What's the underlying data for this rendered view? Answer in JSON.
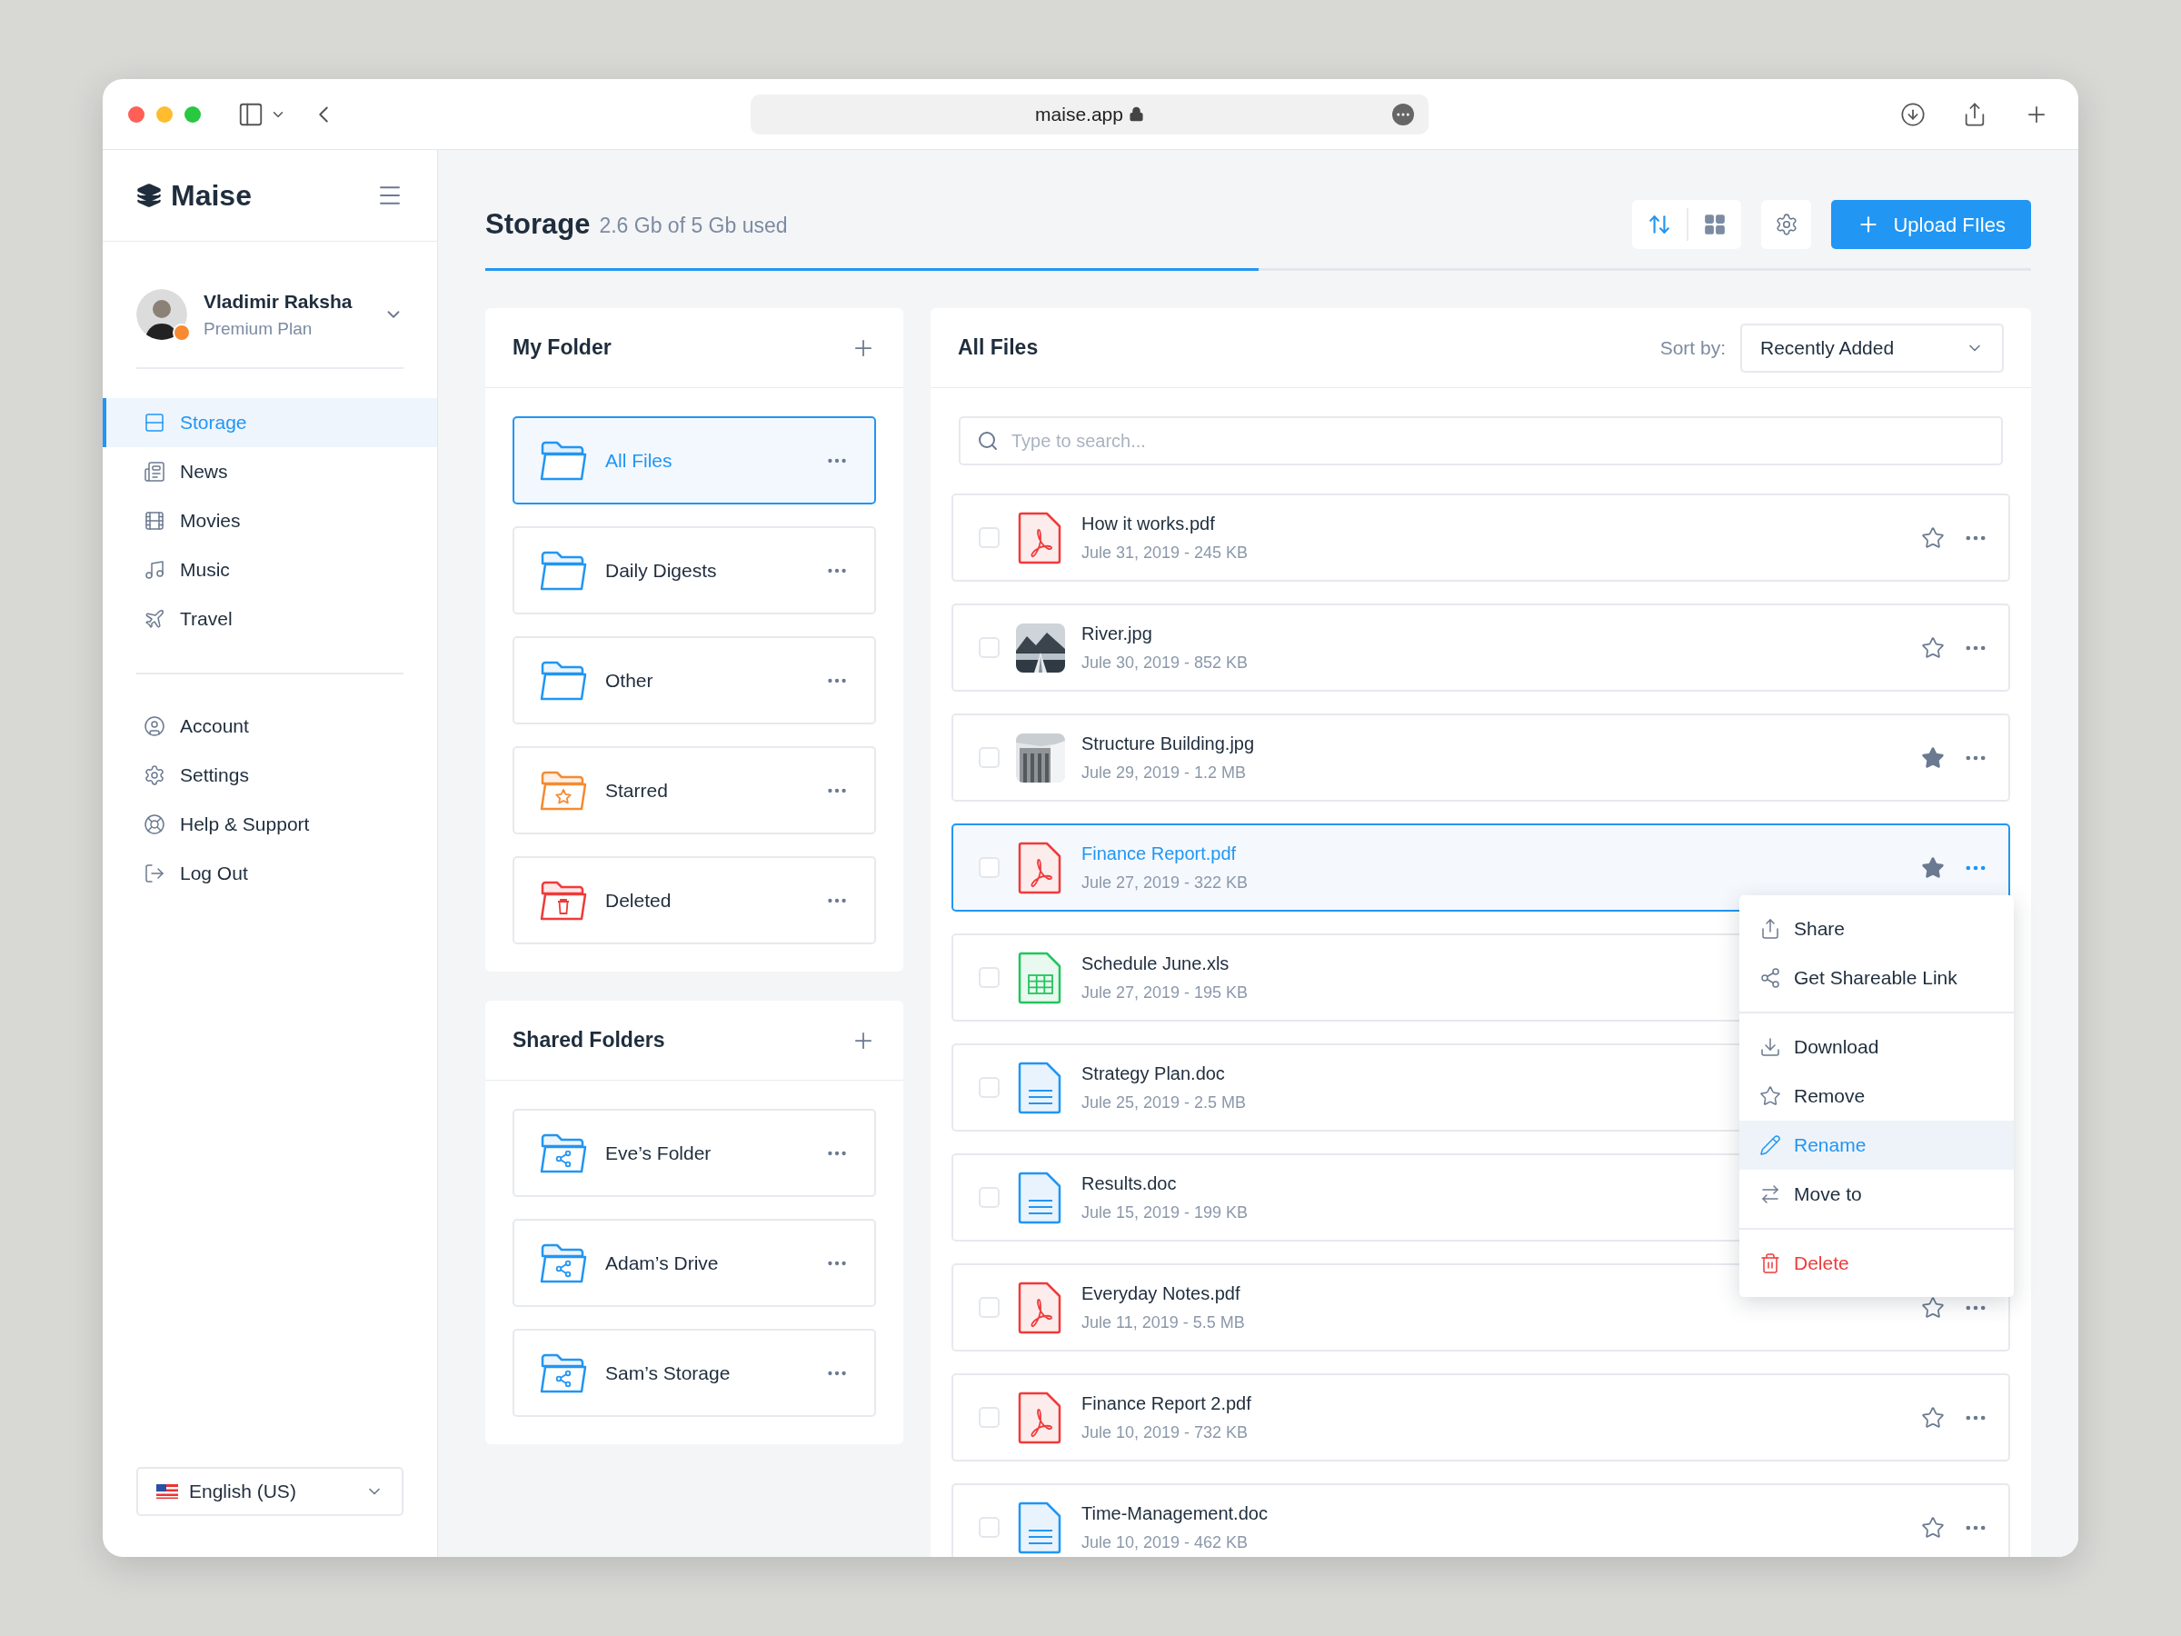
{
  "browser": {
    "address": "maise.app"
  },
  "sidebar": {
    "logo": "Maise",
    "user": {
      "name": "Vladimir Raksha",
      "plan": "Premium Plan"
    },
    "nav": [
      {
        "label": "Storage",
        "selected": true
      },
      {
        "label": "News",
        "selected": false
      },
      {
        "label": "Movies",
        "selected": false
      },
      {
        "label": "Music",
        "selected": false
      },
      {
        "label": "Travel",
        "selected": false
      }
    ],
    "account_menu": [
      {
        "label": "Account"
      },
      {
        "label": "Settings"
      },
      {
        "label": "Help & Support"
      },
      {
        "label": "Log Out"
      }
    ],
    "language": "English (US)"
  },
  "header": {
    "title": "Storage",
    "usage": "2.6 Gb of 5 Gb used",
    "level": 0.5,
    "view_buttons": [
      {
        "selected": true
      },
      {
        "selected": false
      }
    ],
    "upload_button": "Upload FIles"
  },
  "my_folder": {
    "title": "My Folder",
    "folders": [
      {
        "name": "All Files",
        "kind": "plain",
        "selected": true
      },
      {
        "name": "Daily Digests",
        "kind": "plain",
        "selected": false
      },
      {
        "name": "Other",
        "kind": "plain",
        "selected": false
      },
      {
        "name": "Starred",
        "kind": "starred",
        "selected": false
      },
      {
        "name": "Deleted",
        "kind": "deleted",
        "selected": false
      }
    ]
  },
  "shared_folders": {
    "title": "Shared Folders",
    "folders": [
      {
        "name": "Eve’s Folder",
        "kind": "shared",
        "selected": false
      },
      {
        "name": "Adam’s Drive",
        "kind": "shared",
        "selected": false
      },
      {
        "name": "Sam’s Storage",
        "kind": "shared",
        "selected": false
      }
    ]
  },
  "all_files": {
    "title": "All Files",
    "sort_label": "Sort by:",
    "sort_value": "Recently Added",
    "search_placeholder": "Type to search...",
    "files": [
      {
        "name": "How it works.pdf",
        "meta": "Jule 31, 2019 - 245 KB",
        "kind": "pdf",
        "checked": false,
        "selected": false,
        "starred": false
      },
      {
        "name": "River.jpg",
        "meta": "Jule 30, 2019 - 852 KB",
        "checked": false,
        "selected": false,
        "starred": false
      },
      {
        "name": "Structure Building.jpg",
        "meta": "Jule 29, 2019 - 1.2 MB",
        "checked": false,
        "selected": false,
        "starred": true
      },
      {
        "name": "Finance Report.pdf",
        "meta": "Jule 27, 2019 - 322 KB",
        "kind": "pdf",
        "checked": false,
        "selected": true,
        "starred": true
      },
      {
        "name": "Schedule June.xls",
        "meta": "Jule 27, 2019 - 195 KB",
        "kind": "xls",
        "checked": false,
        "selected": false
      },
      {
        "name": "Strategy Plan.doc",
        "meta": "Jule 25, 2019 - 2.5 MB",
        "kind": "doc",
        "checked": false,
        "selected": false
      },
      {
        "name": "Results.doc",
        "meta": "Jule 15, 2019 - 199 KB",
        "kind": "doc",
        "checked": false,
        "selected": false
      },
      {
        "name": "Everyday Notes.pdf",
        "meta": "Jule 11, 2019 - 5.5 MB",
        "kind": "pdf",
        "checked": false,
        "selected": false,
        "starred": false
      },
      {
        "name": "Finance Report 2.pdf",
        "meta": "Jule 10, 2019 - 732 KB",
        "kind": "pdf",
        "checked": false,
        "selected": false,
        "starred": false
      },
      {
        "name": "Time-Management.doc",
        "meta": "Jule 10, 2019 - 462 KB",
        "kind": "doc",
        "checked": false,
        "selected": false,
        "starred": false
      }
    ],
    "context_menu": [
      [
        {
          "label": "Share",
          "kind": "share",
          "selected": false
        },
        {
          "label": "Get Shareable Link",
          "kind": "link",
          "selected": false
        }
      ],
      [
        {
          "label": "Download",
          "kind": "download",
          "selected": false
        },
        {
          "label": "Remove",
          "kind": "remove",
          "selected": false
        },
        {
          "label": "Rename",
          "kind": "rename",
          "selected": true
        },
        {
          "label": "Move to",
          "kind": "move",
          "selected": false
        }
      ],
      [
        {
          "label": "Delete",
          "kind": "delete",
          "selected": false
        }
      ]
    ]
  }
}
